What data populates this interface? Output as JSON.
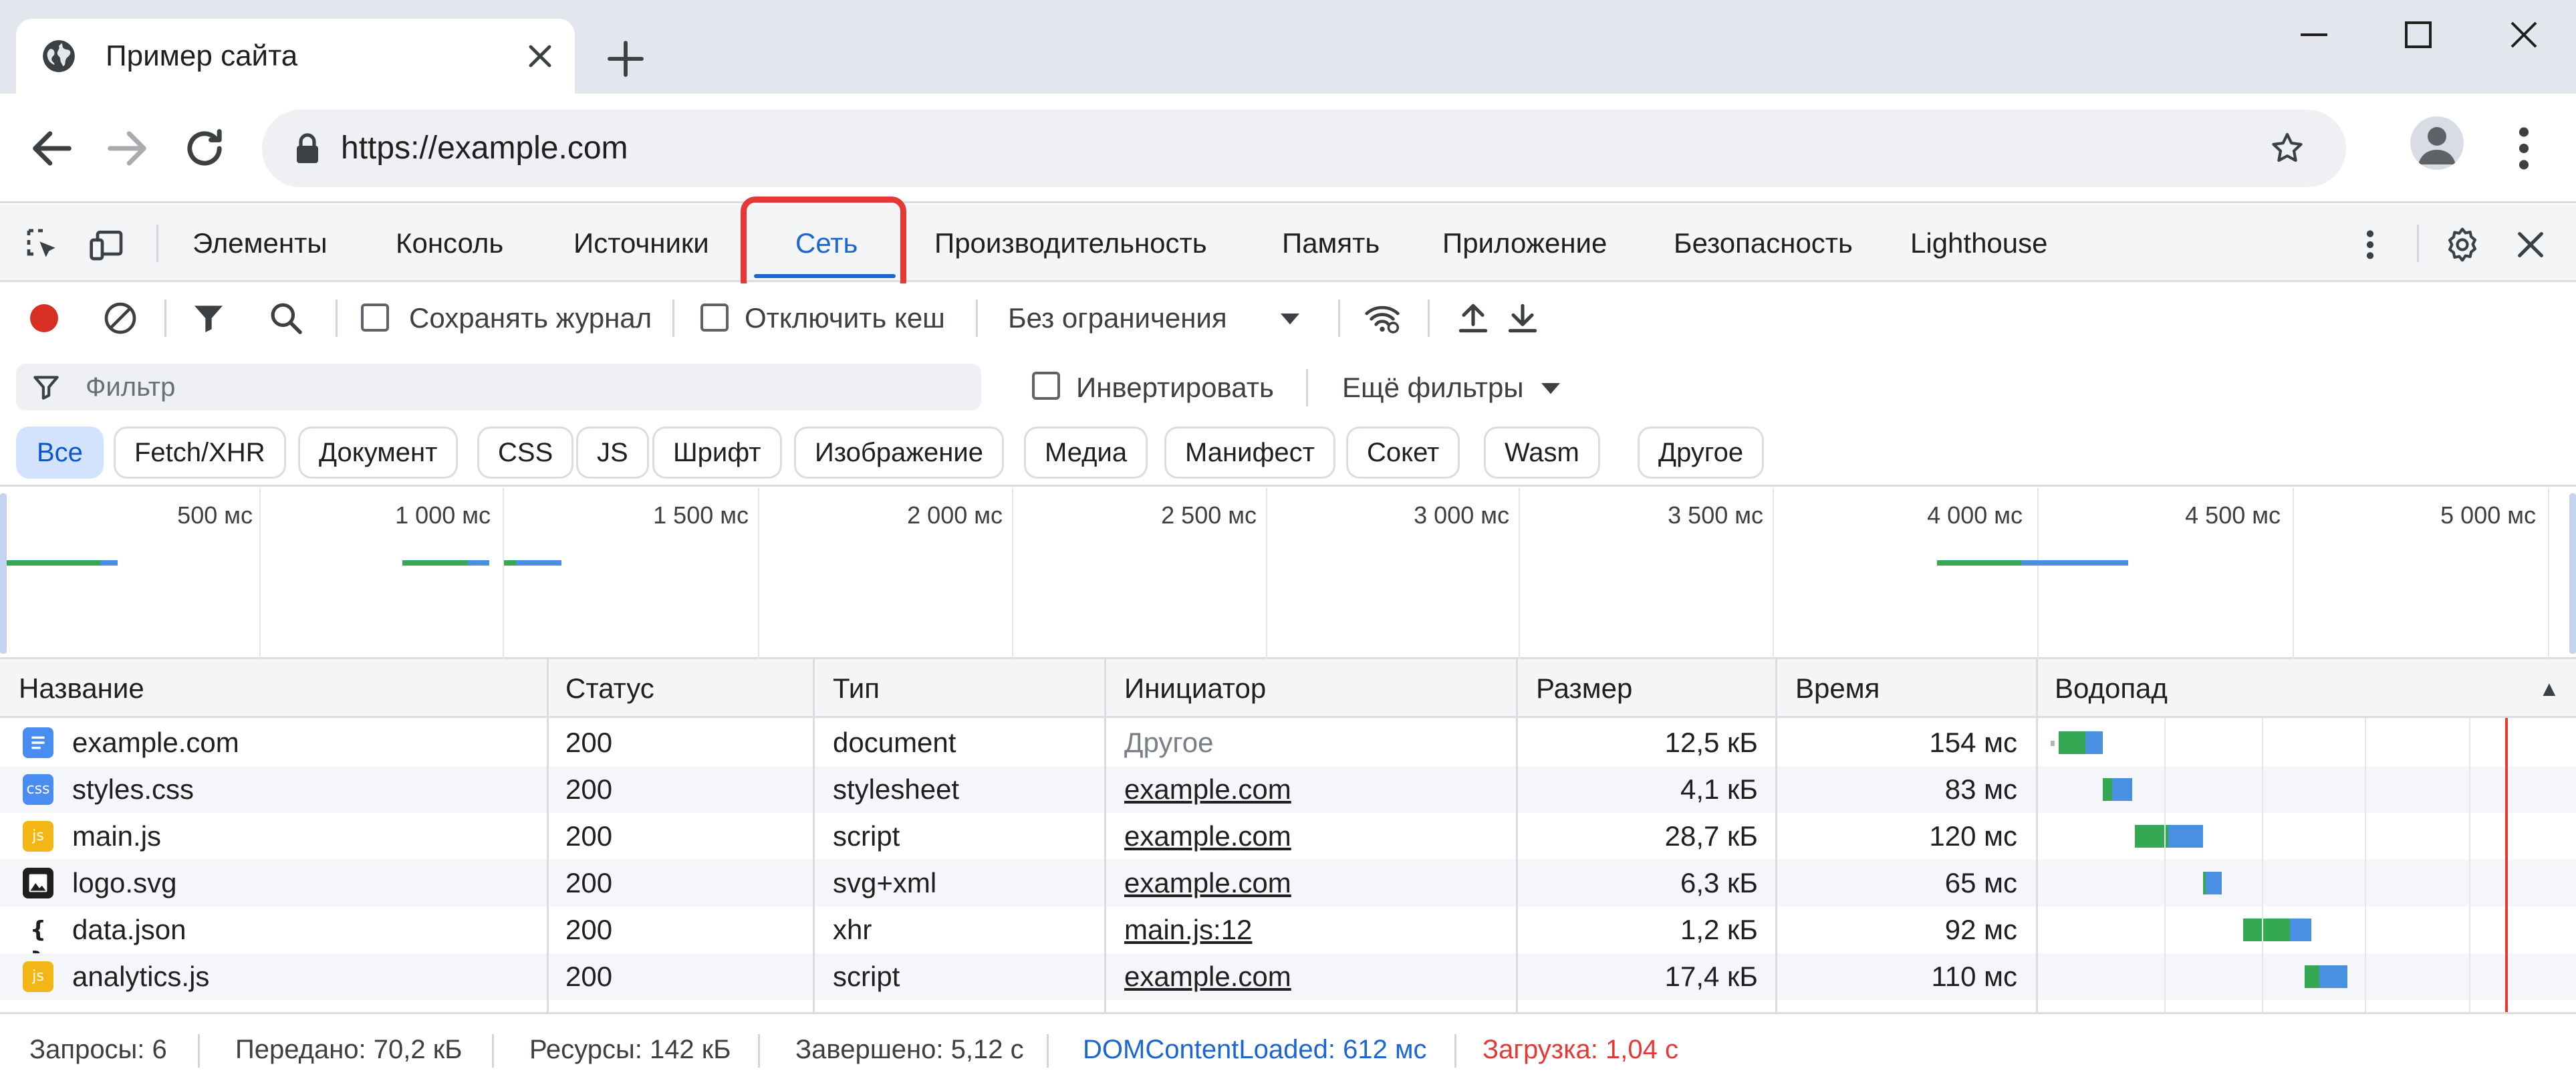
{
  "browser": {
    "tab_title": "Пример сайта",
    "url": "https://example.com"
  },
  "devtools": {
    "tabs": [
      {
        "label": "Элементы"
      },
      {
        "label": "Консоль"
      },
      {
        "label": "Источники"
      },
      {
        "label": "Сеть",
        "active": true
      },
      {
        "label": "Производительность"
      },
      {
        "label": "Память"
      },
      {
        "label": "Приложение"
      },
      {
        "label": "Безопасность"
      },
      {
        "label": "Lighthouse"
      }
    ]
  },
  "network": {
    "preserve_log_label": "Сохранять журнал",
    "disable_cache_label": "Отключить кеш",
    "throttling_value": "Без ограничения",
    "filter_placeholder": "Фильтр",
    "invert_label": "Инвертировать",
    "more_filters_label": "Ещё фильтры",
    "type_filters": [
      "Все",
      "Fetch/XHR",
      "Документ",
      "CSS",
      "JS",
      "Шрифт",
      "Изображение",
      "Медиа",
      "Манифест",
      "Сокет",
      "Wasm",
      "Другое"
    ],
    "selected_type_filter": "Все",
    "overview_ticks": [
      "500 мс",
      "1 000 мс",
      "1 500 мс",
      "2 000 мс",
      "2 500 мс",
      "3 000 мс",
      "3 500 мс",
      "4 000 мс",
      "4 500 мс",
      "5 000 мс"
    ],
    "columns": [
      "Название",
      "Статус",
      "Тип",
      "Инициатор",
      "Размер",
      "Время",
      "Водопад"
    ],
    "waterfall_sort_indicator": "▲",
    "requests": [
      {
        "name": "example.com",
        "icon": "document-icon",
        "status": "200",
        "type": "document",
        "initiator": "Другое",
        "size": "12,5 кБ",
        "time": "154 мс"
      },
      {
        "name": "styles.css",
        "icon": "css-icon",
        "status": "200",
        "type": "stylesheet",
        "initiator": "example.com",
        "size": "4,1 кБ",
        "time": "83 мс"
      },
      {
        "name": "main.js",
        "icon": "js-icon",
        "status": "200",
        "type": "script",
        "initiator": "example.com",
        "size": "28,7 кБ",
        "time": "120 мс"
      },
      {
        "name": "logo.svg",
        "icon": "image-icon",
        "status": "200",
        "type": "svg+xml",
        "initiator": "example.com",
        "size": "6,3 кБ",
        "time": "65 мс"
      },
      {
        "name": "data.json",
        "icon": "braces-icon",
        "status": "200",
        "type": "xhr",
        "initiator": "main.js:12",
        "size": "1,2 кБ",
        "time": "92 мс"
      },
      {
        "name": "analytics.js",
        "icon": "js-icon",
        "status": "200",
        "type": "script",
        "initiator": "example.com",
        "size": "17,4 кБ",
        "time": "110 мс"
      }
    ],
    "icon_labels": {
      "css": "css",
      "js": "js"
    },
    "summary": {
      "requests": "Запросы: 6",
      "transferred": "Передано: 70,2 кБ",
      "resources": "Ресурсы: 142 кБ",
      "finished": "Завершено: 5,12 с",
      "dom_content_loaded": "DOMContentLoaded: 612 мс",
      "load": "Загрузка: 1,04 с"
    }
  },
  "colors": {
    "accent": "#1a66d2",
    "waiting_green": "#34a853",
    "download_blue": "#4a90e2",
    "load_red": "#e53935",
    "record_red": "#d93025",
    "dom_blue": "#1a66d2"
  }
}
